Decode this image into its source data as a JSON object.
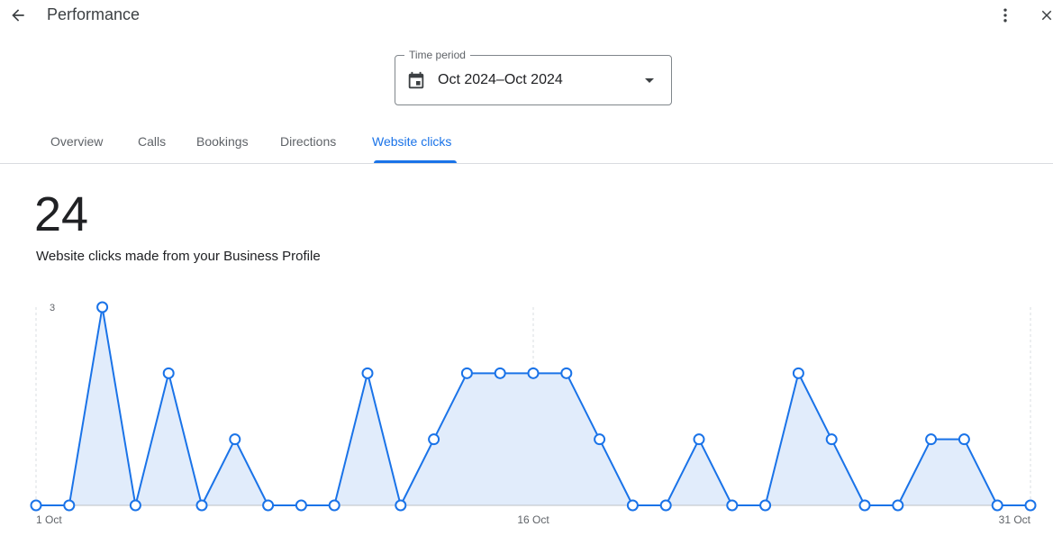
{
  "header": {
    "title": "Performance",
    "icons": {
      "back": "arrow-back-icon",
      "more": "more-vert-icon",
      "close": "close-icon"
    }
  },
  "time_period": {
    "label": "Time period",
    "value": "Oct 2024–Oct 2024",
    "icon": "calendar-icon"
  },
  "tabs": [
    {
      "label": "Overview",
      "active": false
    },
    {
      "label": "Calls",
      "active": false
    },
    {
      "label": "Bookings",
      "active": false
    },
    {
      "label": "Directions",
      "active": false
    },
    {
      "label": "Website clicks",
      "active": true
    }
  ],
  "summary": {
    "total": "24",
    "description": "Website clicks made from your Business Profile"
  },
  "colors": {
    "accent": "#1a73e8",
    "area_fill": "#e1ecfb"
  },
  "chart_data": {
    "type": "area",
    "x": [
      1,
      2,
      3,
      4,
      5,
      6,
      7,
      8,
      9,
      10,
      11,
      12,
      13,
      14,
      15,
      16,
      17,
      18,
      19,
      20,
      21,
      22,
      23,
      24,
      25,
      26,
      27,
      28,
      29,
      30,
      31
    ],
    "values": [
      0,
      0,
      3,
      0,
      2,
      0,
      1,
      0,
      0,
      0,
      2,
      0,
      1,
      2,
      2,
      2,
      2,
      1,
      0,
      0,
      1,
      0,
      0,
      2,
      1,
      0,
      0,
      1,
      1,
      0,
      0
    ],
    "x_ticks": [
      {
        "x": 1,
        "label": "1 Oct"
      },
      {
        "x": 16,
        "label": "16 Oct"
      },
      {
        "x": 31,
        "label": "31 Oct"
      }
    ],
    "y_tick_label": "3",
    "ylim": [
      0,
      3
    ],
    "grid": true
  }
}
